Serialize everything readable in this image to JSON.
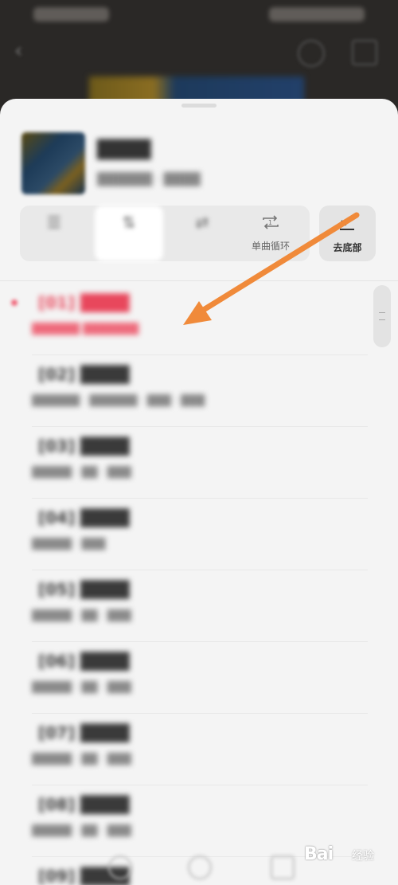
{
  "sheet": {
    "controls": [
      {
        "icon": "list-icon",
        "label": ""
      },
      {
        "icon": "order-icon",
        "label": ""
      },
      {
        "icon": "shuffle-icon",
        "label": ""
      },
      {
        "icon": "repeat-one-icon",
        "label": "单曲循环"
      }
    ],
    "scroll_to_bottom": {
      "icon": "download-check-icon",
      "label": "去底部"
    }
  },
  "tracks_count_visible": 9,
  "colors": {
    "accent": "#e8475c",
    "arrow": "#f08a3a",
    "sheet_bg": "#f4f4f4"
  },
  "watermark": {
    "brand": "Bai",
    "sub": "经验"
  }
}
